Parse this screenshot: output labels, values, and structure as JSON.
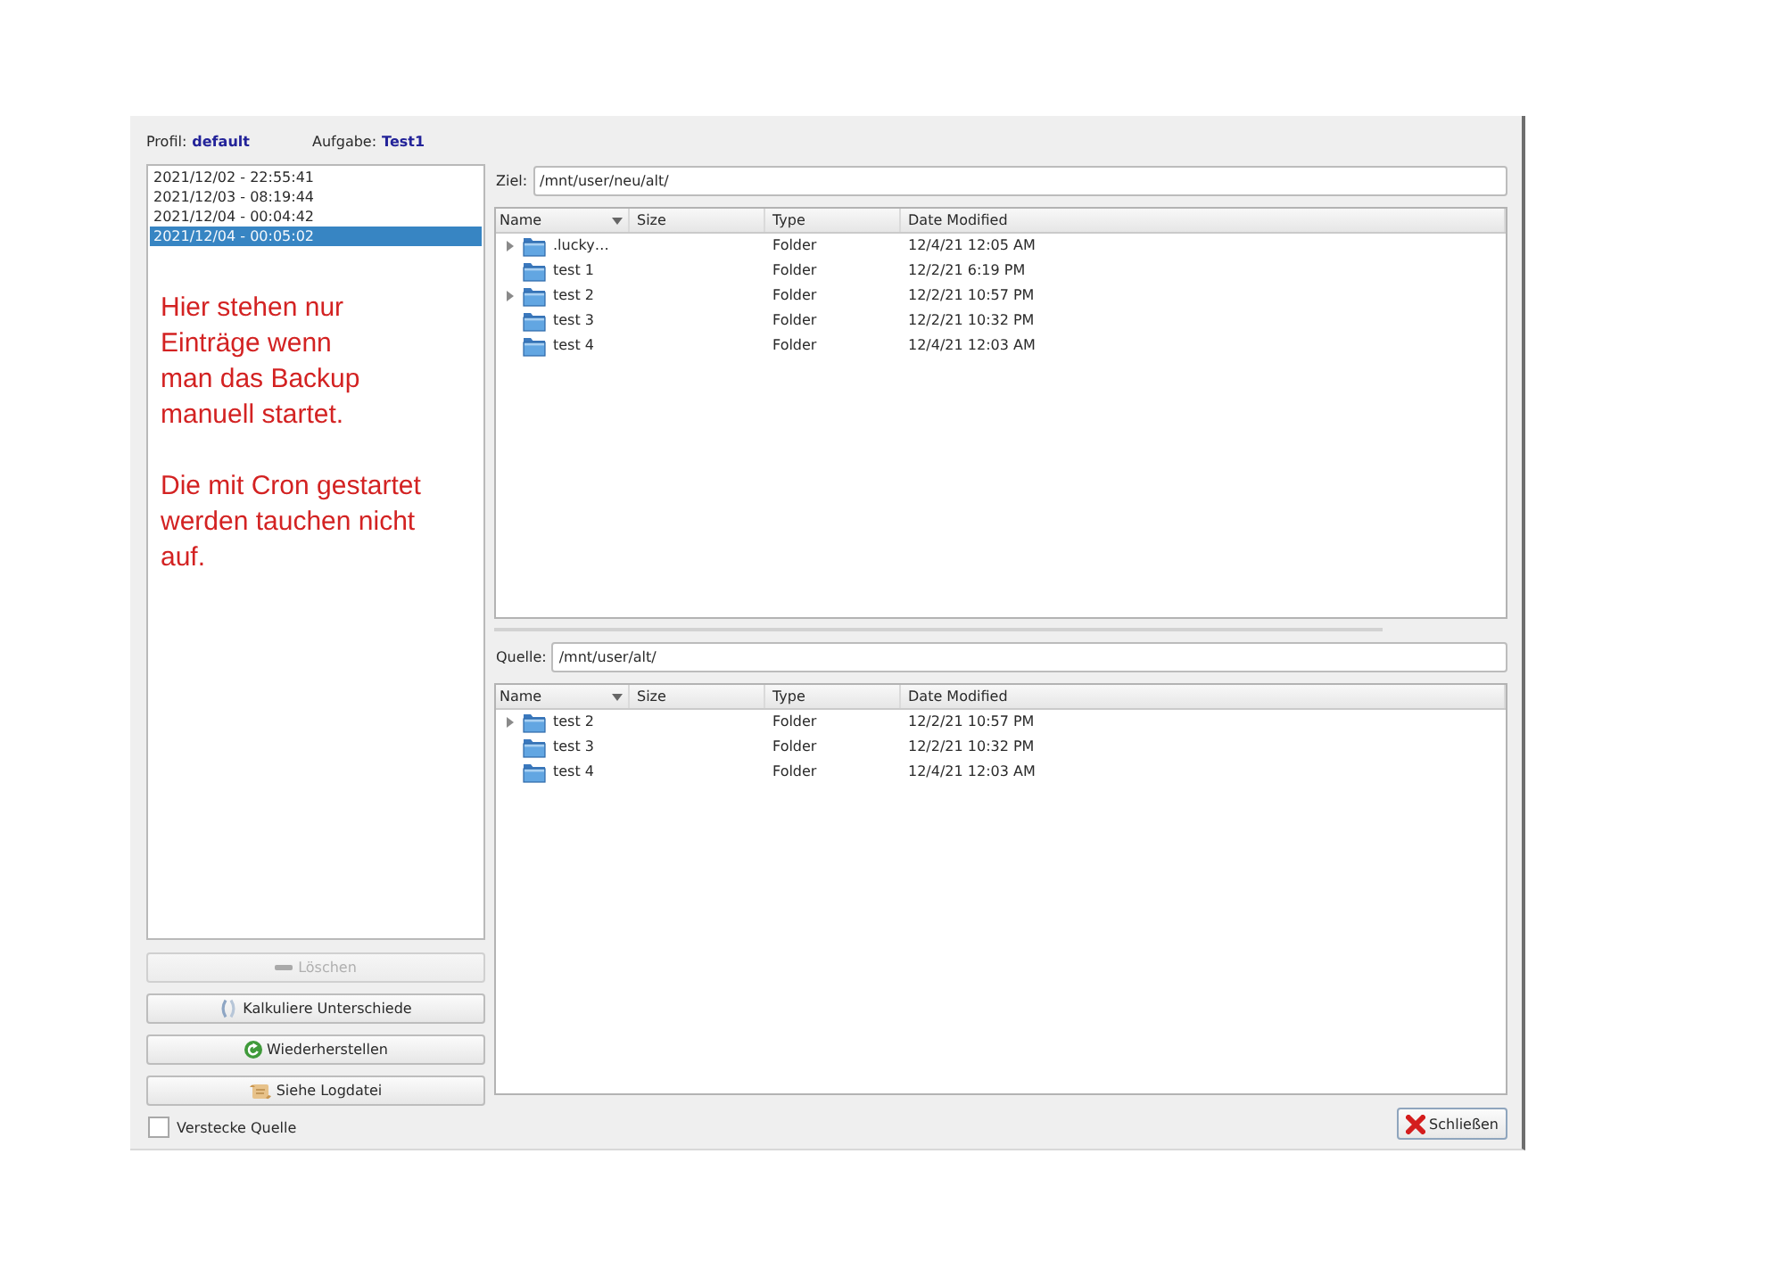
{
  "header": {
    "profile_label": "Profil:",
    "profile": "default",
    "task_label": "Aufgabe:",
    "task": "Test1"
  },
  "backups": [
    {
      "label": "2021/12/02 - 22:55:41",
      "selected": false
    },
    {
      "label": "2021/12/03 - 08:19:44",
      "selected": false
    },
    {
      "label": "2021/12/04 - 00:04:42",
      "selected": false
    },
    {
      "label": "2021/12/04 - 00:05:02",
      "selected": true
    }
  ],
  "annotation": [
    "Hier stehen nur\nEinträge wenn\nman das Backup\nmanuell startet.",
    "Die mit Cron gestartet\nwerden tauchen nicht\nauf."
  ],
  "buttons": [
    {
      "kind": "delete",
      "label": "Löschen",
      "disabled": true
    },
    {
      "kind": "compare",
      "label": "Kalkuliere Unterschiede",
      "disabled": false
    },
    {
      "kind": "restore",
      "label": "Wiederherstellen",
      "disabled": false
    },
    {
      "kind": "log",
      "label": "Siehe Logdatei",
      "disabled": false
    }
  ],
  "hide_source": {
    "label": "Verstecke Quelle",
    "checked": false
  },
  "panes": [
    {
      "label": "Ziel:",
      "value": "/mnt/user/neu/alt/",
      "columns": [
        {
          "label": "Name",
          "sorted": true
        },
        {
          "label": "Size",
          "sorted": false
        },
        {
          "label": "Type",
          "sorted": false
        },
        {
          "label": "Date Modified",
          "sorted": false
        }
      ],
      "rows": [
        {
          "name": ".lucky…",
          "type": "Folder",
          "date": "12/4/21 12:05 AM",
          "expandable": true
        },
        {
          "name": "test 1",
          "type": "Folder",
          "date": "12/2/21 6:19 PM",
          "expandable": false
        },
        {
          "name": "test 2",
          "type": "Folder",
          "date": "12/2/21 10:57 PM",
          "expandable": true
        },
        {
          "name": "test 3",
          "type": "Folder",
          "date": "12/2/21 10:32 PM",
          "expandable": false
        },
        {
          "name": "test 4",
          "type": "Folder",
          "date": "12/4/21 12:03 AM",
          "expandable": false
        }
      ]
    },
    {
      "label": "Quelle:",
      "value": "/mnt/user/alt/",
      "columns": [
        {
          "label": "Name",
          "sorted": true
        },
        {
          "label": "Size",
          "sorted": false
        },
        {
          "label": "Type",
          "sorted": false
        },
        {
          "label": "Date Modified",
          "sorted": false
        }
      ],
      "rows": [
        {
          "name": "test 2",
          "type": "Folder",
          "date": "12/2/21 10:57 PM",
          "expandable": true
        },
        {
          "name": "test 3",
          "type": "Folder",
          "date": "12/2/21 10:32 PM",
          "expandable": false
        },
        {
          "name": "test 4",
          "type": "Folder",
          "date": "12/4/21 12:03 AM",
          "expandable": false
        }
      ]
    }
  ],
  "close_button": {
    "label": "Schließen"
  }
}
